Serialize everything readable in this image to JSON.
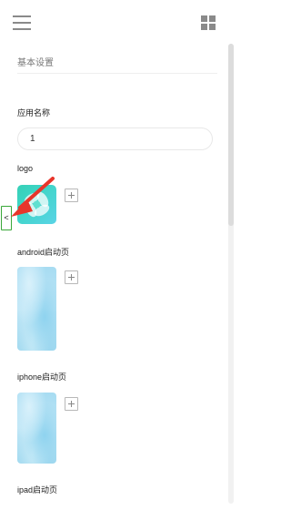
{
  "header": {
    "menu_icon": "hamburger-menu-icon",
    "grid_icon": "grid-apps-icon"
  },
  "section": {
    "title": "基本设置"
  },
  "form": {
    "app_name_label": "应用名称",
    "app_name_value": "1",
    "logo_label": "logo",
    "android_label": "android启动页",
    "iphone_label": "iphone启动页",
    "ipad_label": "ipad启动页"
  },
  "side_toggle": {
    "label": "<"
  },
  "colors": {
    "toggle_border": "#3aa83a",
    "annotation_arrow": "#e8352b",
    "logo_teal": "#36d1b7"
  }
}
